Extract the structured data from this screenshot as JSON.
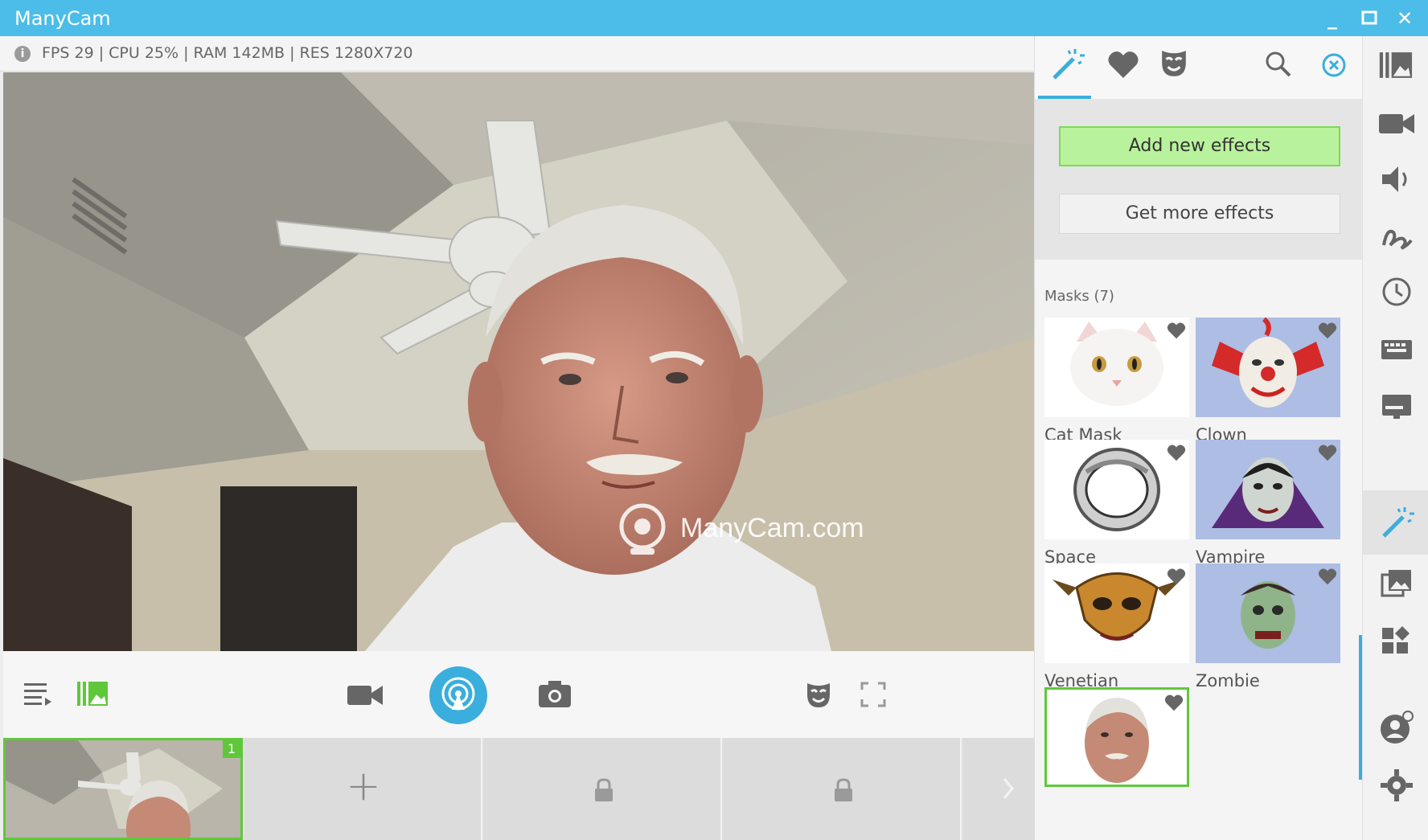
{
  "window": {
    "title": "ManyCam",
    "minimize": "_",
    "maximize": "☐",
    "close": "✕"
  },
  "status": {
    "text": "FPS 29 | CPU 25% | RAM 142MB | RES 1280X720"
  },
  "video": {
    "watermark": "ManyCam.com"
  },
  "thumbnails": {
    "badge": "1",
    "add": "+"
  },
  "panel": {
    "add_effects": "Add new effects",
    "get_more": "Get more effects",
    "masks_header": "Masks (7)",
    "masks": [
      {
        "label": "Cat Mask"
      },
      {
        "label": "Clown"
      },
      {
        "label": "Space"
      },
      {
        "label": "Vampire"
      },
      {
        "label": "Venetian"
      },
      {
        "label": "Zombie"
      },
      {
        "label": ""
      }
    ]
  },
  "colors": {
    "accent": "#3aaedc",
    "title_bar": "#4cbde8",
    "green_button": "#b9f29c",
    "active_green": "#5fc83a"
  }
}
